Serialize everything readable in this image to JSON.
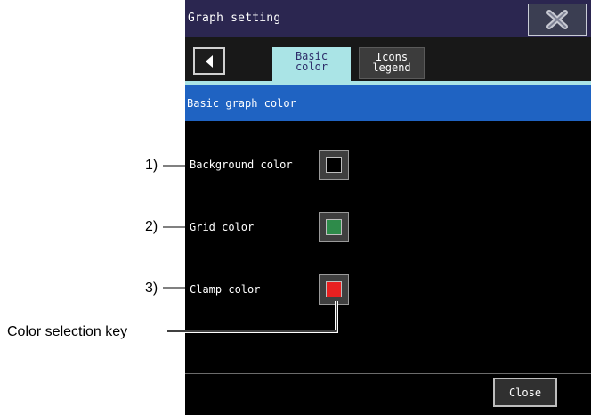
{
  "window": {
    "title": "Graph setting",
    "close_icon": "close-x-icon"
  },
  "tabs": {
    "back_icon": "triangle-left-icon",
    "items": [
      {
        "label_line1": "Basic",
        "label_line2": "color",
        "active": true
      },
      {
        "label_line1": "Icons",
        "label_line2": "legend",
        "active": false
      }
    ]
  },
  "section": {
    "title": "Basic graph color"
  },
  "rows": [
    {
      "label": "Background color",
      "swatch_color": "#000000"
    },
    {
      "label": "Grid color",
      "swatch_color": "#2e8b4a"
    },
    {
      "label": "Clamp color",
      "swatch_color": "#e82020"
    }
  ],
  "footer": {
    "close_label": "Close"
  },
  "callouts": {
    "row1": "1)",
    "row2": "2)",
    "row3": "3)",
    "color_key": "Color selection key"
  },
  "colors": {
    "title_bar": "#2b2650",
    "active_tab": "#aae4e6",
    "section_header": "#1f63c2",
    "screen_background": "#000000"
  }
}
